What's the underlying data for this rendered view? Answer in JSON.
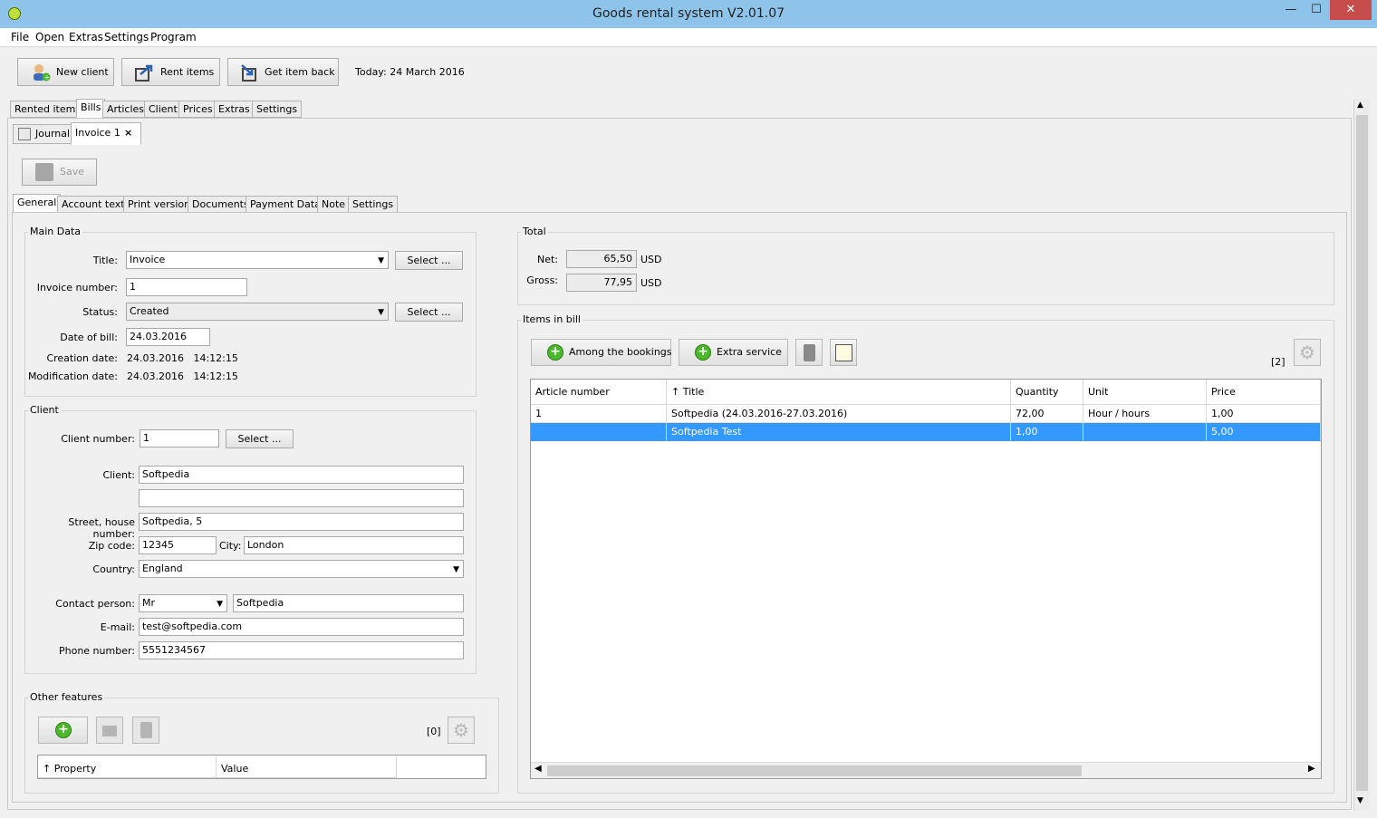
{
  "window": {
    "title": "Goods rental system V2.01.07",
    "minimize": "—",
    "maximize": "☐",
    "close": "✕"
  },
  "menu": [
    "File",
    "Open",
    "Extras",
    "Settings",
    "Program"
  ],
  "toolbar": {
    "new_client": "New client",
    "rent_items": "Rent items",
    "get_item_back": "Get item back",
    "today": "Today: 24 March 2016"
  },
  "main_tabs": [
    "Rented items",
    "Bills",
    "Articles",
    "Client",
    "Prices",
    "Extras",
    "Settings"
  ],
  "doc_tabs": {
    "journal": "Journal",
    "invoice": "Invoice 1",
    "close": "×"
  },
  "save_label": "Save",
  "sub_tabs": [
    "General",
    "Account text",
    "Print version",
    "Documents",
    "Payment Data",
    "Note",
    "Settings"
  ],
  "main_data": {
    "label": "Main Data",
    "title_label": "Title:",
    "title_value": "Invoice",
    "select": "Select ...",
    "invoice_number_label": "Invoice number:",
    "invoice_number": "1",
    "status_label": "Status:",
    "status_value": "Created",
    "date_label": "Date of bill:",
    "date_value": "24.03.2016",
    "creation_label": "Creation date:",
    "creation_value": "24.03.2016   14:12:15",
    "mod_label": "Modification date:",
    "mod_value": "24.03.2016   14:12:15"
  },
  "client": {
    "label": "Client",
    "number_label": "Client number:",
    "number": "1",
    "select": "Select ...",
    "client_label": "Client:",
    "client": "Softpedia",
    "client2": "",
    "street_label": "Street, house number:",
    "street": "Softpedia, 5",
    "zip_label": "Zip code:",
    "zip": "12345",
    "city_label": "City:",
    "city": "London",
    "country_label": "Country:",
    "country": "England",
    "contact_label": "Contact person:",
    "salutation": "Mr",
    "contact": "Softpedia",
    "email_label": "E-mail:",
    "email": "test@softpedia.com",
    "phone_label": "Phone number:",
    "phone": "5551234567"
  },
  "other": {
    "label": "Other features",
    "count": "[0]",
    "col_property": "↑ Property",
    "col_value": "Value"
  },
  "total": {
    "label": "Total",
    "net_label": "Net:",
    "net": "65,50",
    "gross_label": "Gross:",
    "gross": "77,95",
    "currency": "USD"
  },
  "items": {
    "label": "Items in bill",
    "among": "Among the bookings",
    "extra": "Extra service",
    "count": "[2]",
    "columns": [
      "Article number",
      "↑ Title",
      "Quantity",
      "Unit",
      "Price"
    ],
    "rows": [
      [
        "1",
        "Softpedia (24.03.2016-27.03.2016)",
        "72,00",
        "Hour / hours",
        "1,00"
      ],
      [
        "",
        "Softpedia Test",
        "1,00",
        "",
        "5,00"
      ]
    ]
  },
  "colors": {
    "titlebar": "#8ec3ea",
    "selection": "#3399ff",
    "close": "#c74d4d"
  }
}
